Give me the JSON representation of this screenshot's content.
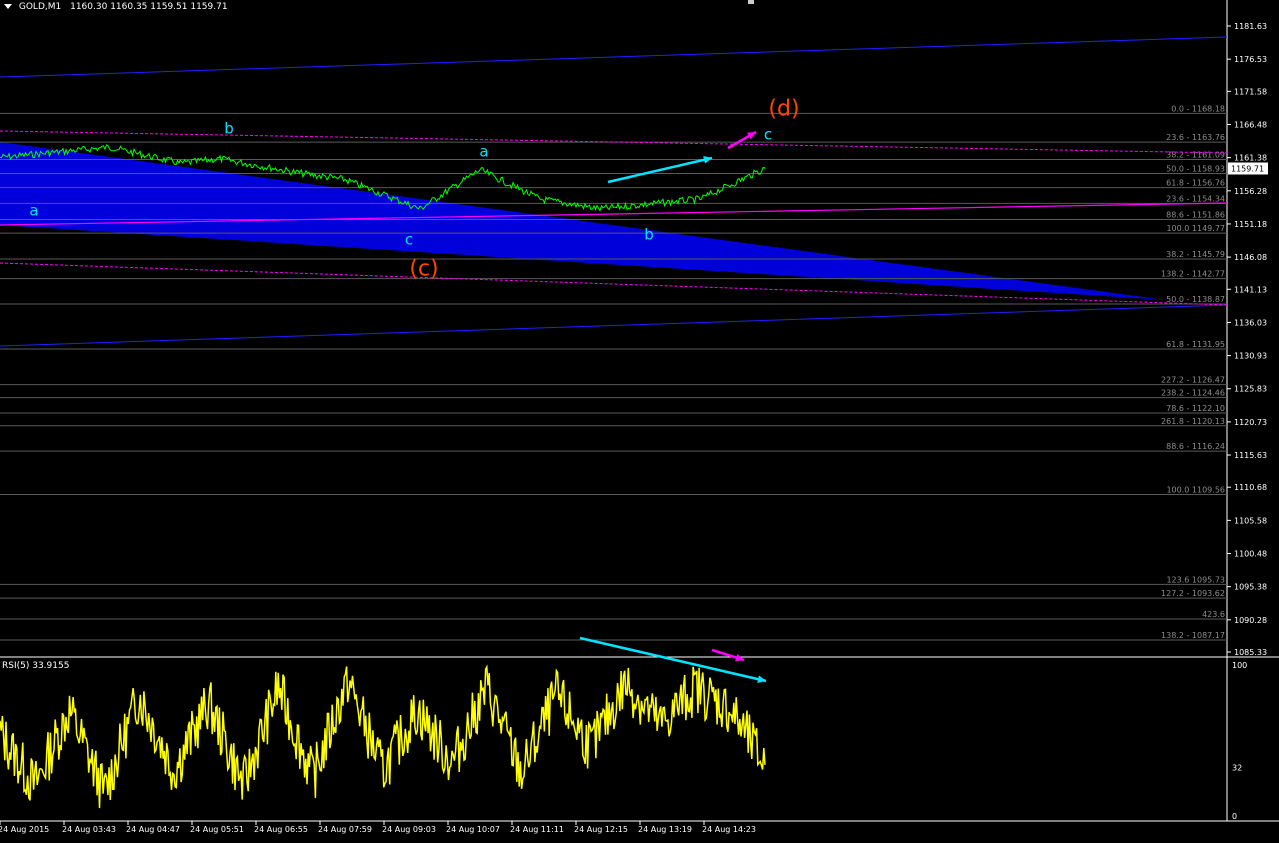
{
  "header": {
    "symbol": "GOLD,M1",
    "ohlc": "1160.30 1160.35 1159.51 1159.71"
  },
  "rsi_header": {
    "title": "RSI(5) 33.9155"
  },
  "colors": {
    "background": "#000000",
    "price_line": "#00ff00",
    "rsi_line": "#ffff00",
    "channel": "#0000ff",
    "fill": "#0000e6",
    "fib": "#5a5a5a",
    "fib_text": "#8c8c8c",
    "magenta": "#ff00ff",
    "cyan": "#00e5ff",
    "orange": "#ff4500",
    "axis": "#ffffff"
  },
  "chart_data": [
    {
      "type": "line",
      "title": "GOLD,M1",
      "y_ticks": [
        "1181.63",
        "1176.53",
        "1171.58",
        "1166.48",
        "1161.38",
        "1156.28",
        "1151.18",
        "1146.08",
        "1141.13",
        "1136.03",
        "1130.93",
        "1125.83",
        "1120.73",
        "1115.63",
        "1110.68",
        "1105.58",
        "1100.48",
        "1095.38",
        "1090.28",
        "1085.33"
      ],
      "ylim": [
        1085.33,
        1181.63
      ],
      "x_ticks": [
        "24 Aug 2015",
        "24 Aug 03:43",
        "24 Aug 04:47",
        "24 Aug 05:51",
        "24 Aug 06:55",
        "24 Aug 07:59",
        "24 Aug 09:03",
        "24 Aug 10:07",
        "24 Aug 11:11",
        "24 Aug 12:15",
        "24 Aug 13:19",
        "24 Aug 14:23"
      ],
      "current_price": "1159.71",
      "price_series": {
        "name": "GOLD,M1",
        "x": [
          "24 Aug 2015",
          "24 Aug 03:43",
          "24 Aug 04:47",
          "24 Aug 05:51",
          "24 Aug 06:55",
          "24 Aug 07:59",
          "24 Aug 09:03",
          "24 Aug 10:07",
          "24 Aug 11:11",
          "24 Aug 12:15",
          "24 Aug 13:19",
          "24 Aug 14:23"
        ],
        "values": [
          1161.4,
          1163.0,
          1160.5,
          1161.2,
          1159.0,
          1158.0,
          1153.5,
          1159.5,
          1155.0,
          1153.5,
          1155.0,
          1159.7
        ]
      },
      "fib_levels": [
        {
          "label": "0.0 - 1168.18",
          "value": 1168.18
        },
        {
          "label": "23.6 - 1163.76",
          "value": 1163.76
        },
        {
          "label": "38.2 - 1161.09",
          "value": 1161.09
        },
        {
          "label": "50.0 - 1158.93",
          "value": 1158.93
        },
        {
          "label": "61.8 - 1156.76",
          "value": 1156.76
        },
        {
          "label": "23.6 - 1154.34",
          "value": 1154.34
        },
        {
          "label": "88.6 - 1151.86",
          "value": 1151.86
        },
        {
          "label": "100.0 1149.77",
          "value": 1149.77
        },
        {
          "label": "38.2 - 1145.79",
          "value": 1145.79
        },
        {
          "label": "138.2 - 1142.77",
          "value": 1142.77
        },
        {
          "label": "50.0 - 1138.87",
          "value": 1138.87
        },
        {
          "label": "61.8 - 1131.95",
          "value": 1131.95
        },
        {
          "label": "227.2 - 1126.47",
          "value": 1126.47
        },
        {
          "label": "238.2 - 1124.46",
          "value": 1124.46
        },
        {
          "label": "78.6 - 1122.10",
          "value": 1122.1
        },
        {
          "label": "261.8 - 1120.13",
          "value": 1120.13
        },
        {
          "label": "88.6 - 1116.24",
          "value": 1116.24
        },
        {
          "label": "100.0 1109.56",
          "value": 1109.56
        },
        {
          "label": "123.6 1095.73",
          "value": 1095.73
        },
        {
          "label": "127.2 - 1093.62",
          "value": 1093.62
        },
        {
          "label": "423.6",
          "value": 1090.4
        },
        {
          "label": "138.2 - 1087.17",
          "value": 1087.17
        }
      ],
      "wave_labels": [
        {
          "text": "a",
          "color": "cyan",
          "x": "24 Aug 2015",
          "y": 1153.0
        },
        {
          "text": "b",
          "color": "cyan",
          "x": "24 Aug 04:47",
          "y": 1166.0
        },
        {
          "text": "c",
          "color": "cyan",
          "x": "24 Aug 09:03",
          "y": 1149.0
        },
        {
          "text": "a",
          "color": "cyan",
          "x": "24 Aug 10:07",
          "y": 1161.5
        },
        {
          "text": "b",
          "color": "cyan",
          "x": "24 Aug 12:15",
          "y": 1149.0
        },
        {
          "text": "c",
          "color": "cyan",
          "x": "24 Aug 14:23",
          "y": 1165.5
        },
        {
          "text": "(c)",
          "color": "orange",
          "x": "24 Aug 09:03",
          "y": 1143.0
        },
        {
          "text": "(d)",
          "color": "orange",
          "x": "24 Aug 14:23",
          "y": 1169.0
        }
      ]
    },
    {
      "type": "line",
      "title": "RSI(5) 33.9155",
      "y_ticks": [
        "100",
        "32",
        "0"
      ],
      "ylim": [
        0,
        100
      ],
      "series": [
        {
          "name": "RSI(5)",
          "values": [
            55,
            20,
            70,
            15,
            80,
            30,
            75,
            20,
            85,
            25,
            90,
            30,
            70,
            35,
            85,
            28,
            80,
            45,
            88,
            60,
            85,
            70,
            33.9
          ]
        }
      ]
    }
  ]
}
